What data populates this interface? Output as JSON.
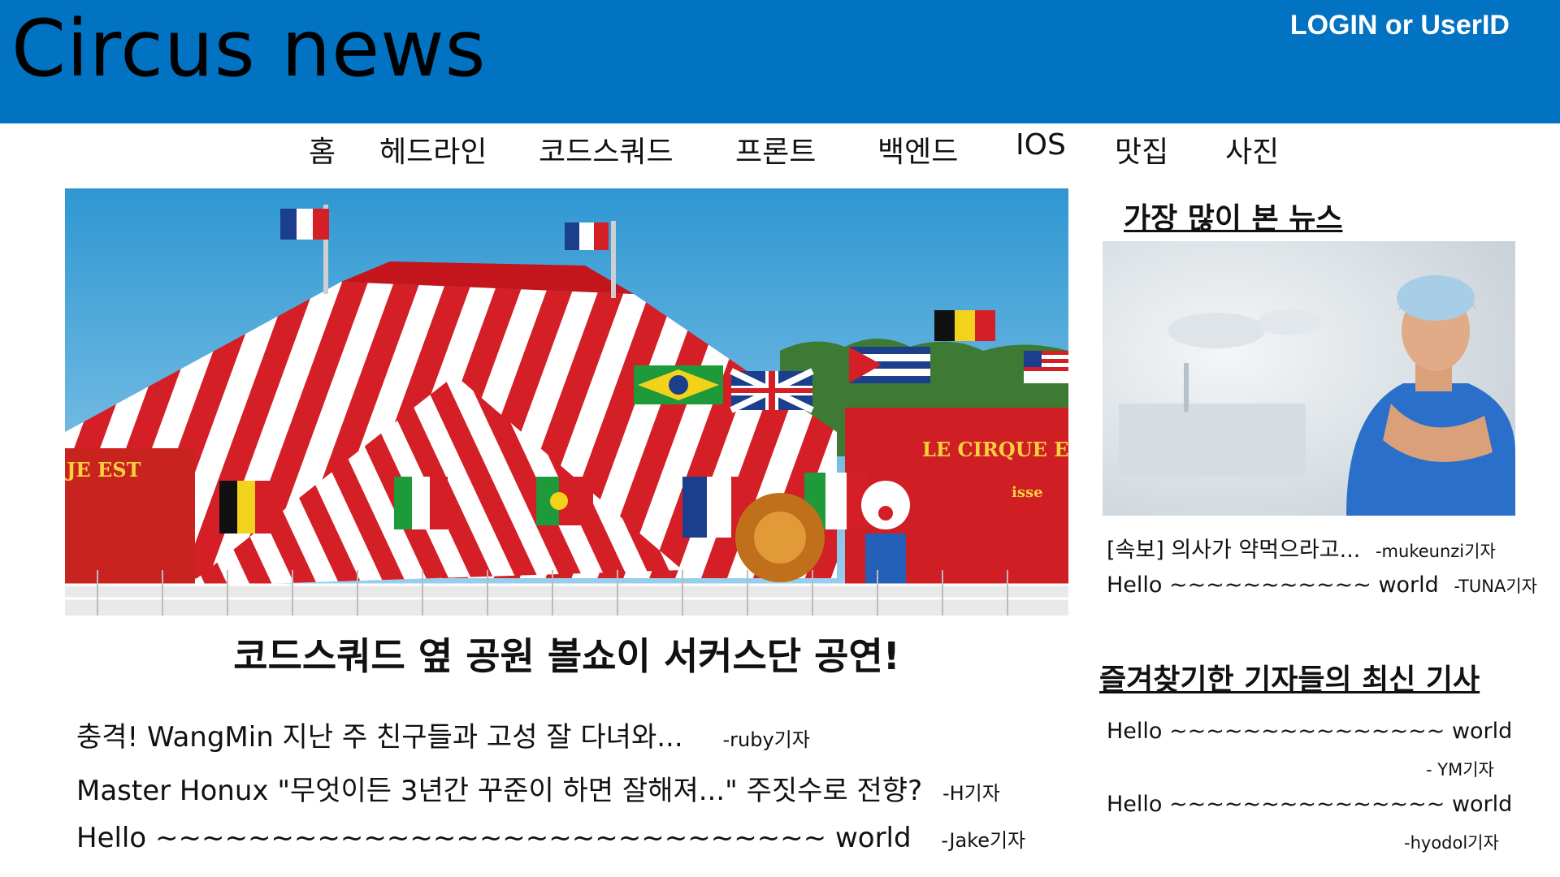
{
  "header": {
    "title": "Circus news",
    "login_label": "LOGIN or UserID",
    "background_color": "#0272c2"
  },
  "nav": {
    "items": [
      "홈",
      "헤드라인",
      "코드스쿼드",
      "프론트",
      "백엔드",
      "IOS",
      "맛집",
      "사진"
    ]
  },
  "main": {
    "hero_image_icon": "circus-tent-photo",
    "hero_sign_left": "JE EST",
    "hero_sign_right": "LE CIRQUE EST",
    "hero_sign_small": "isse",
    "headline": "코드스쿼드 옆 공원 볼쇼이 서커스단 공연!",
    "articles": [
      {
        "title": "충격! WangMin 지난 주 친구들과 고성 잘 다녀와...",
        "author": "-ruby기자"
      },
      {
        "title": "Master Honux \"무엇이든 3년간 꾸준이 하면 잘해져...\" 주짓수로 전향?",
        "author": "-H기자"
      },
      {
        "title": "Hello ~~~~~~~~~~~~~~~~~~~~~~~~~~~~~ world",
        "author": "-Jake기자"
      }
    ]
  },
  "sidebar": {
    "most_viewed_title": "가장 많이 본 뉴스",
    "most_viewed_image_icon": "doctor-photo",
    "most_viewed": [
      {
        "title": "[속보] 의사가 약먹으라고...",
        "author": "-mukeunzi기자"
      },
      {
        "title": "Hello ~~~~~~~~~~~ world",
        "author": "-TUNA기자"
      }
    ],
    "favorites_title": "즐겨찾기한 기자들의 최신 기사",
    "favorites": [
      {
        "title": "Hello ~~~~~~~~~~~~~~~ world",
        "author": "- YM기자"
      },
      {
        "title": "Hello ~~~~~~~~~~~~~~~ world",
        "author": "-hyodol기자"
      }
    ]
  }
}
